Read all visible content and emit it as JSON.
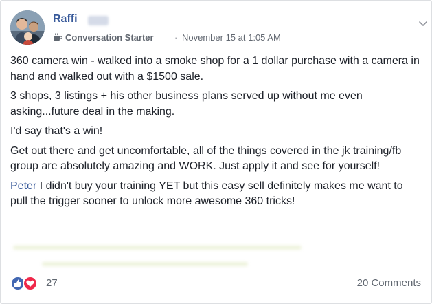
{
  "post": {
    "author": {
      "name": "Raffi"
    },
    "badge": {
      "label": "Conversation Starter",
      "icon": "coffee-cup-icon"
    },
    "separator": "·",
    "timestamp": "November 15 at 1:05 AM",
    "options_icon": "chevron-down-icon",
    "body": {
      "p1": "360 camera win - walked into a smoke shop for a 1 dollar purchase with a camera in hand and walked out with a $1500 sale.",
      "p2": "3 shops, 3 listings + his other business plans served up without me even asking...future deal in the making.",
      "p3": "I'd say that's a win!",
      "p4": "Get out there and get uncomfortable, all of the things covered in the jk training/fb group are absolutely amazing and WORK. Just apply it and see for yourself!",
      "p5_mention": "Peter",
      "p5_text": " I didn't buy your training YET but this easy sell definitely makes me want to pull the trigger sooner to unlock more awesome 360 tricks!"
    },
    "footer": {
      "reactions": {
        "count": "27",
        "icons": [
          "like-icon",
          "love-icon"
        ]
      },
      "comments_label": "20 Comments"
    },
    "colors": {
      "link_blue": "#365899",
      "like_blue": "#4267b2",
      "love_red": "#f0284a",
      "meta_gray": "#616770"
    }
  }
}
